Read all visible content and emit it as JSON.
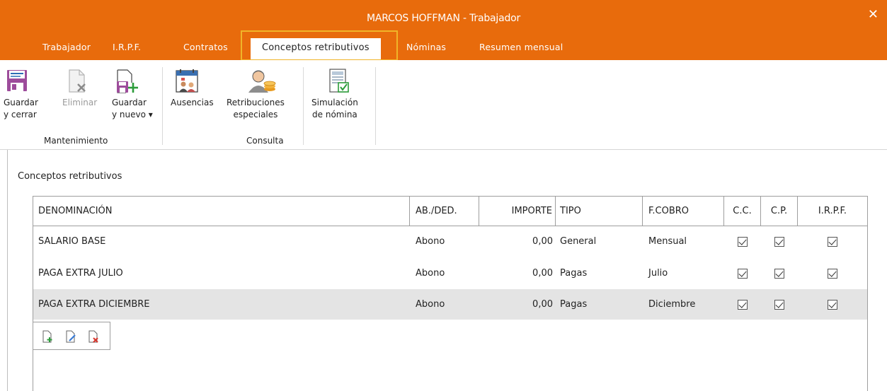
{
  "window": {
    "title": "MARCOS HOFFMAN - Trabajador",
    "close_glyph": "✕"
  },
  "tabs": [
    {
      "label": "Trabajador"
    },
    {
      "label": "I.R.P.F."
    },
    {
      "label": "Contratos"
    },
    {
      "label": "Conceptos retributivos",
      "active": true
    },
    {
      "label": "Nóminas"
    },
    {
      "label": "Resumen mensual"
    }
  ],
  "ribbon": {
    "guardar_cerrar": {
      "line1": "Guardar",
      "line2": "y cerrar",
      "icon": "save-close-icon"
    },
    "eliminar": {
      "line1": "Eliminar",
      "icon": "delete-document-icon",
      "disabled": true
    },
    "guardar_nuevo": {
      "line1": "Guardar",
      "line2": "y nuevo ▾",
      "icon": "save-new-icon"
    },
    "ausencias": {
      "line1": "Ausencias",
      "icon": "calendar-people-icon"
    },
    "retribuciones": {
      "line1": "Retribuciones",
      "line2": "especiales",
      "icon": "person-coins-icon"
    },
    "simulacion": {
      "line1": "Simulación",
      "line2": "de nómina",
      "icon": "document-check-icon"
    },
    "group_mantenimiento": "Mantenimiento",
    "group_consulta": "Consulta"
  },
  "section": {
    "title": "Conceptos retributivos"
  },
  "table": {
    "headers": {
      "denominacion": "DENOMINACIÓN",
      "abded": "AB./DED.",
      "importe": "IMPORTE",
      "tipo": "TIPO",
      "fcobro": "F.COBRO",
      "cc": "C.C.",
      "cp": "C.P.",
      "irpf": "I.R.P.F."
    },
    "rows": [
      {
        "denominacion": "SALARIO BASE",
        "abded": "Abono",
        "importe": "0,00",
        "tipo": "General",
        "fcobro": "Mensual",
        "cc": true,
        "cp": true,
        "irpf": true
      },
      {
        "denominacion": "PAGA EXTRA JULIO",
        "abded": "Abono",
        "importe": "0,00",
        "tipo": "Pagas",
        "fcobro": "Julio",
        "cc": true,
        "cp": true,
        "irpf": true
      },
      {
        "denominacion": "PAGA EXTRA DICIEMBRE",
        "abded": "Abono",
        "importe": "0,00",
        "tipo": "Pagas",
        "fcobro": "Diciembre",
        "cc": true,
        "cp": true,
        "irpf": true,
        "selected": true
      }
    ]
  },
  "mini_toolbar": [
    "add-document-icon",
    "edit-document-icon",
    "delete-document-icon"
  ],
  "colors": {
    "accent": "#e86b0c",
    "tab_highlight": "#f0b429",
    "selected_row": "#e4e4e4"
  }
}
